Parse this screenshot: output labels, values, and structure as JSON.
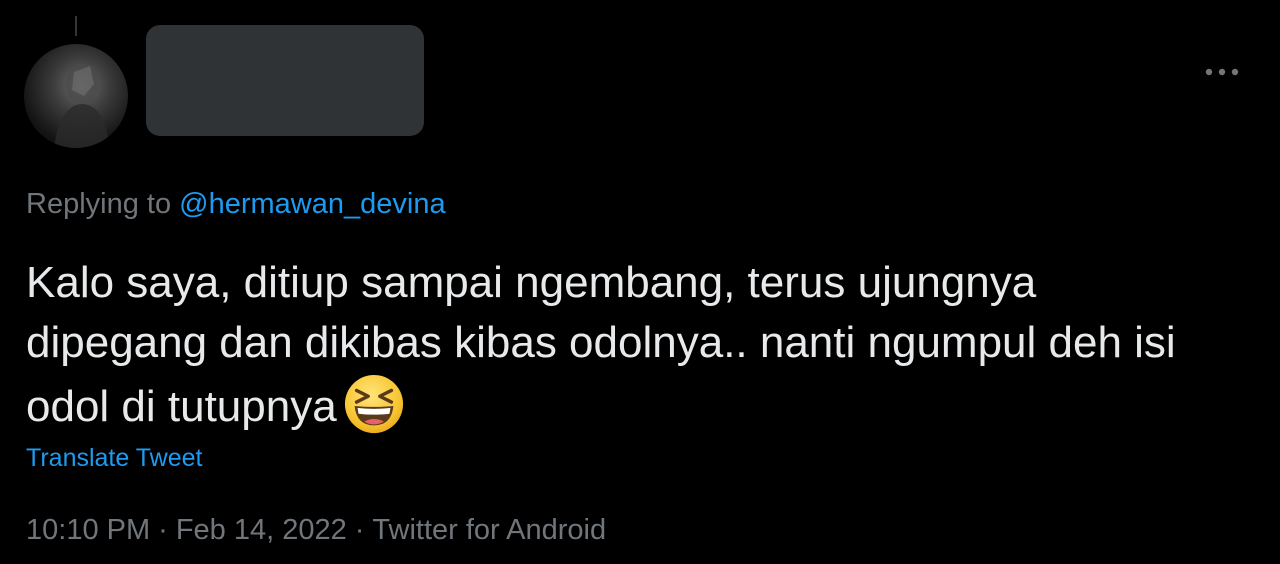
{
  "tweet": {
    "reply_prefix": "Replying to",
    "reply_handle": "@hermawan_devina",
    "text": "Kalo saya, ditiup sampai ngembang, terus ujungnya dipegang dan dikibas kibas odolnya.. nanti ngumpul deh isi odol di tutupnya",
    "emoji": "grinning-squinting-face",
    "translate_label": "Translate Tweet",
    "time": "10:10 PM",
    "date": "Feb 14, 2022",
    "source": "Twitter for Android",
    "separator": "·"
  },
  "icons": {
    "more": "more-horizontal-icon"
  },
  "colors": {
    "background": "#000000",
    "text_primary": "#e7e9ea",
    "text_secondary": "#71767b",
    "link": "#1d9bf0",
    "redaction": "#2f3336"
  }
}
